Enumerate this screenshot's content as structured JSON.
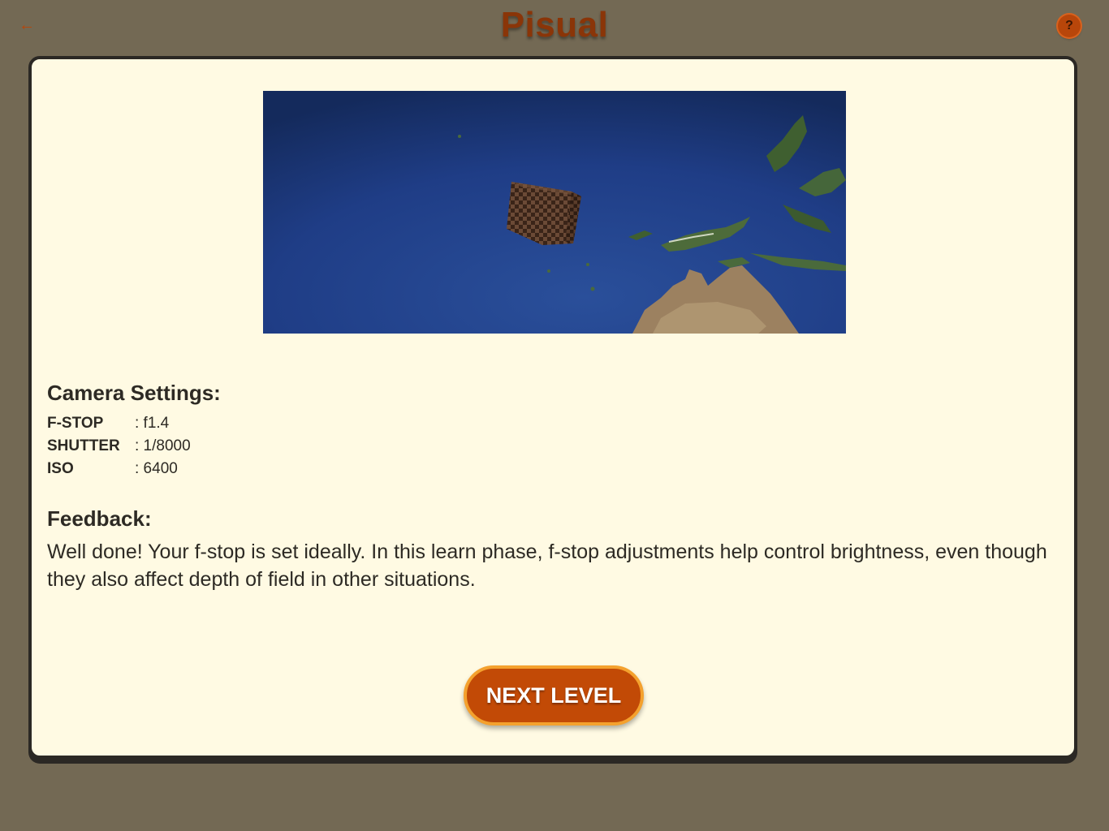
{
  "header": {
    "title": "Pisual",
    "back_icon": "arrow-left-icon",
    "help_label": "?"
  },
  "scene": {
    "description_icon": "rendered-scene"
  },
  "camera_settings": {
    "heading": "Camera Settings:",
    "rows": [
      {
        "label": "F-STOP",
        "value": ": f1.4"
      },
      {
        "label": "SHUTTER",
        "value": ": 1/8000"
      },
      {
        "label": "ISO",
        "value": ": 6400"
      }
    ]
  },
  "feedback": {
    "heading": "Feedback:",
    "text": "Well done! Your f-stop is set ideally. In this learn phase, f-stop adjustments help control brightness, even though they also affect depth of field in other situations."
  },
  "actions": {
    "next_label": "NEXT LEVEL"
  },
  "colors": {
    "background": "#736954",
    "card": "#fffae3",
    "accent": "#c24a06",
    "accent_border": "#f4a12e",
    "title": "#8a3508"
  }
}
